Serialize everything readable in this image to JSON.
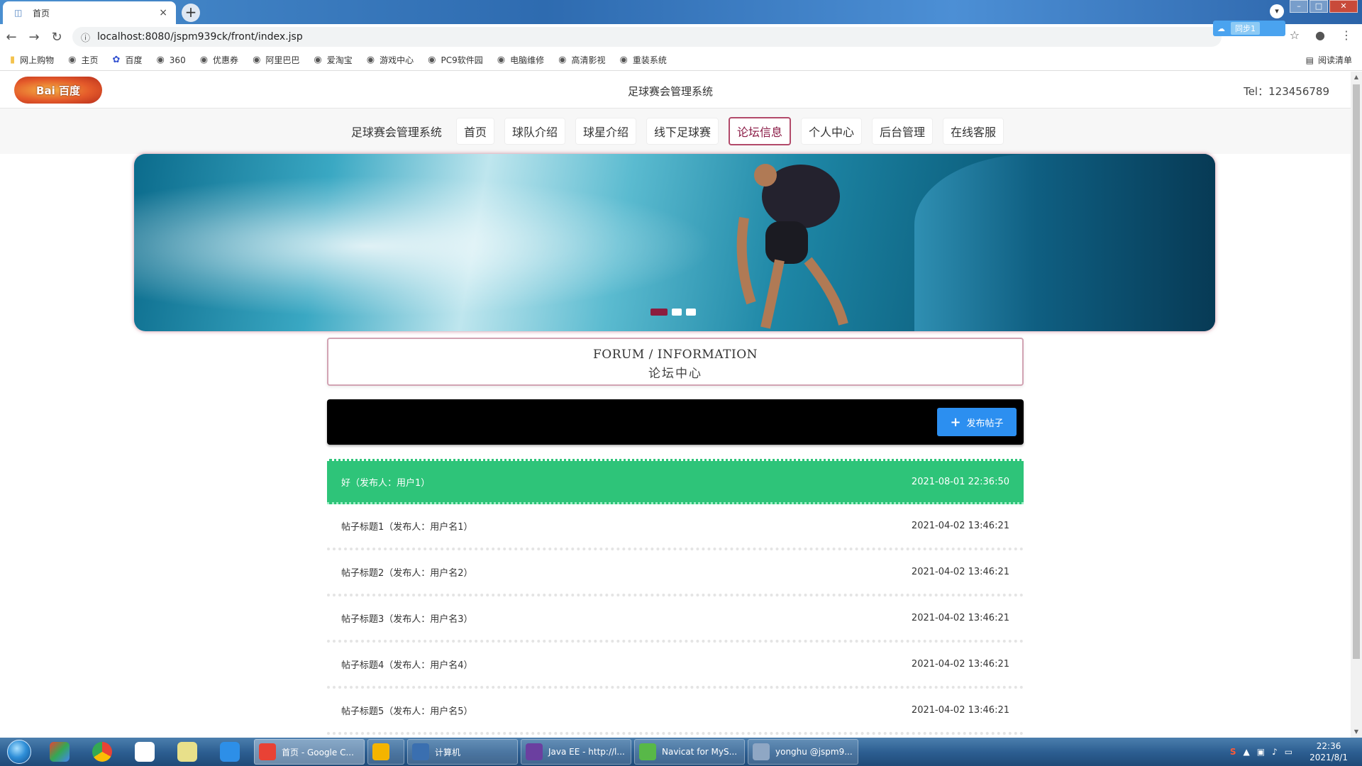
{
  "browser": {
    "tab_title": "首页",
    "tab_close": "×",
    "new_tab": "+",
    "url": "localhost:8080/jspm939ck/front/index.jsp",
    "cloud_ext_label": "同步1",
    "reading_list": "阅读清单",
    "bookmarks": [
      {
        "label": "网上购物",
        "icon": "folder-icon"
      },
      {
        "label": "主页",
        "icon": "globe-icon"
      },
      {
        "label": "百度",
        "icon": "baidu-icon"
      },
      {
        "label": "360",
        "icon": "globe-icon"
      },
      {
        "label": "优惠券",
        "icon": "globe-icon"
      },
      {
        "label": "阿里巴巴",
        "icon": "globe-icon"
      },
      {
        "label": "爱淘宝",
        "icon": "globe-icon"
      },
      {
        "label": "游戏中心",
        "icon": "globe-icon"
      },
      {
        "label": "PC9软件园",
        "icon": "globe-icon"
      },
      {
        "label": "电脑维修",
        "icon": "globe-icon"
      },
      {
        "label": "高清影视",
        "icon": "globe-icon"
      },
      {
        "label": "重装系统",
        "icon": "globe-icon"
      }
    ]
  },
  "site": {
    "logo_text": "Bai 百度",
    "title": "足球赛会管理系统",
    "tel": "Tel：123456789"
  },
  "nav": {
    "brand": "足球赛会管理系统",
    "items": [
      {
        "label": "首页",
        "active": false
      },
      {
        "label": "球队介绍",
        "active": false
      },
      {
        "label": "球星介绍",
        "active": false
      },
      {
        "label": "线下足球赛",
        "active": false
      },
      {
        "label": "论坛信息",
        "active": true
      },
      {
        "label": "个人中心",
        "active": false
      },
      {
        "label": "后台管理",
        "active": false
      },
      {
        "label": "在线客服",
        "active": false
      }
    ]
  },
  "forum": {
    "heading_en": "FORUM / INFORMATION",
    "heading_cn": "论坛中心",
    "publish_label": "发布帖子",
    "posts": [
      {
        "title": "好（发布人：用户1）",
        "time": "2021-08-01 22:36:50"
      },
      {
        "title": "帖子标题1（发布人：用户名1）",
        "time": "2021-04-02 13:46:21"
      },
      {
        "title": "帖子标题2（发布人：用户名2）",
        "time": "2021-04-02 13:46:21"
      },
      {
        "title": "帖子标题3（发布人：用户名3）",
        "time": "2021-04-02 13:46:21"
      },
      {
        "title": "帖子标题4（发布人：用户名4）",
        "time": "2021-04-02 13:46:21"
      },
      {
        "title": "帖子标题5（发布人：用户名5）",
        "time": "2021-04-02 13:46:21"
      }
    ]
  },
  "taskbar": {
    "tasks": [
      {
        "label": "首页 - Google C...",
        "active": true,
        "color": "#e94235"
      },
      {
        "label": "",
        "active": false,
        "color": "#f4b400"
      },
      {
        "label": "计算机",
        "active": false,
        "color": "#3a6fb0"
      },
      {
        "label": "Java EE - http://l...",
        "active": false,
        "color": "#6b3fa0"
      },
      {
        "label": "Navicat for MyS...",
        "active": false,
        "color": "#58b848"
      },
      {
        "label": "yonghu @jspm9...",
        "active": false,
        "color": "#8fa7c4"
      }
    ],
    "time": "22:36",
    "date": "2021/8/1"
  }
}
